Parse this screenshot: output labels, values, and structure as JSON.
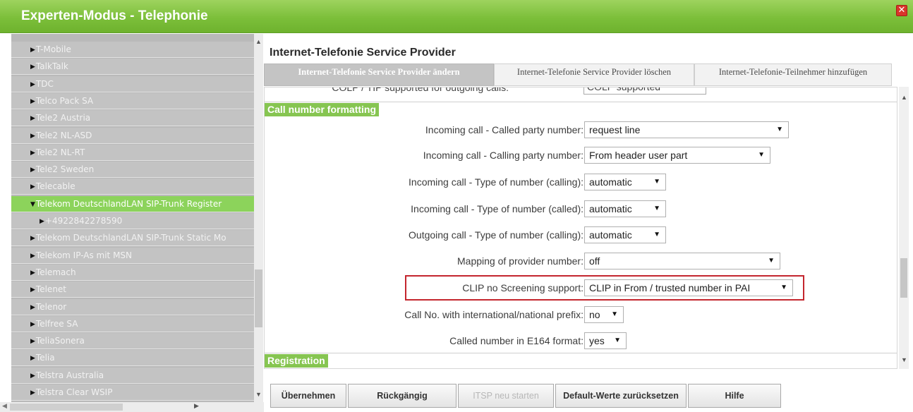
{
  "window": {
    "title": "Experten-Modus - Telephonie",
    "close_glyph": "✕"
  },
  "tree": {
    "items": [
      {
        "label": "T-Mobile",
        "state": "collapsed"
      },
      {
        "label": "TalkTalk",
        "state": "collapsed"
      },
      {
        "label": "TDC",
        "state": "collapsed"
      },
      {
        "label": "Telco Pack SA",
        "state": "collapsed"
      },
      {
        "label": "Tele2 Austria",
        "state": "collapsed"
      },
      {
        "label": "Tele2 NL-ASD",
        "state": "collapsed"
      },
      {
        "label": "Tele2 NL-RT",
        "state": "collapsed"
      },
      {
        "label": "Tele2 Sweden",
        "state": "collapsed"
      },
      {
        "label": "Telecable",
        "state": "collapsed"
      },
      {
        "label": "Telekom DeutschlandLAN SIP-Trunk Register",
        "state": "expanded",
        "selected": true
      },
      {
        "label": "+4922842278590",
        "state": "collapsed",
        "child": true
      },
      {
        "label": "Telekom DeutschlandLAN SIP-Trunk Static Mo",
        "state": "collapsed"
      },
      {
        "label": "Telekom IP-As mit MSN",
        "state": "collapsed"
      },
      {
        "label": "Telemach",
        "state": "collapsed"
      },
      {
        "label": "Telenet",
        "state": "collapsed"
      },
      {
        "label": "Telenor",
        "state": "collapsed"
      },
      {
        "label": "Telfree SA",
        "state": "collapsed"
      },
      {
        "label": "TeliaSonera",
        "state": "collapsed"
      },
      {
        "label": "Telia",
        "state": "collapsed"
      },
      {
        "label": "Telstra Australia",
        "state": "collapsed"
      },
      {
        "label": "Telstra Clear WSIP",
        "state": "collapsed"
      }
    ]
  },
  "panel": {
    "heading": "Internet-Telefonie Service Provider",
    "tabs": [
      {
        "label": "Internet-Telefonie Service Provider ändern",
        "active": true
      },
      {
        "label": "Internet-Telefonie Service Provider löschen",
        "active": false
      },
      {
        "label": "Internet-Telefonie-Teilnehmer hinzufügen",
        "active": false
      }
    ],
    "partial_row": {
      "label": "COLP / TIP supported for outgoing calls:",
      "value": "COLP supported"
    },
    "groups": {
      "call_number_formatting": "Call number formatting",
      "registration": "Registration"
    },
    "fields": [
      {
        "label": "Incoming call - Called party number:",
        "value": "request line"
      },
      {
        "label": "Incoming call - Calling party number:",
        "value": "From header user part"
      },
      {
        "label": "Incoming call - Type of number (calling):",
        "value": "automatic"
      },
      {
        "label": "Incoming call - Type of number (called):",
        "value": "automatic"
      },
      {
        "label": "Outgoing call - Type of number (calling):",
        "value": "automatic"
      },
      {
        "label": "Mapping of provider number:",
        "value": "off"
      },
      {
        "label": "CLIP no Screening support:",
        "value": "CLIP in From / trusted number in PAI"
      },
      {
        "label": "Call No. with international/national prefix:",
        "value": "no"
      },
      {
        "label": "Called number in E164 format:",
        "value": "yes"
      }
    ]
  },
  "buttons": {
    "apply": "Übernehmen",
    "undo": "Rückgängig",
    "restart": "ITSP neu starten",
    "defaults": "Default-Werte zurücksetzen",
    "help": "Hilfe"
  },
  "glyphs": {
    "tri_right": "▶",
    "tri_down": "▼",
    "select_arrow": "▼",
    "scroll_up": "▲",
    "scroll_down": "▼",
    "scroll_left": "◀",
    "scroll_right": "▶"
  },
  "colors": {
    "title_green": "#7cbf3a",
    "selected_green": "#8cd35b",
    "group_badge": "#86c551",
    "highlight_red": "#c4262e"
  }
}
